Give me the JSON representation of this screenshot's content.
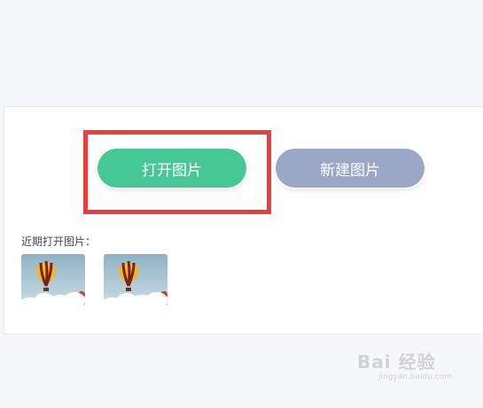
{
  "buttons": {
    "open_label": "打开图片",
    "new_label": "新建图片"
  },
  "recent": {
    "label": "近期打开图片：",
    "thumbnails": [
      {
        "icon": "balloon-image"
      },
      {
        "icon": "balloon-image"
      }
    ]
  },
  "watermark": {
    "brand": "Bai 经验",
    "site": "jingyan.baidu.com"
  },
  "colors": {
    "open_button": "#46c796",
    "new_button": "#9ba7c6",
    "highlight": "#ee3b3b",
    "background": "#f6f7fb"
  }
}
